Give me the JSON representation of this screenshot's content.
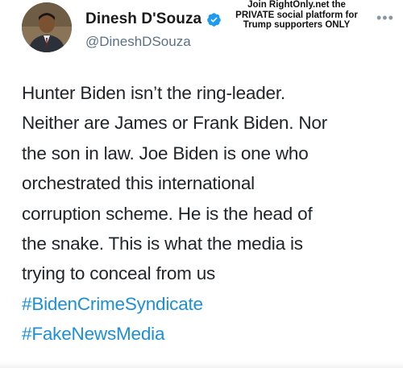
{
  "user": {
    "display_name": "Dinesh D'Souza",
    "handle": "@DineshDSouza",
    "verified": true,
    "avatar_icon": "profile-photo"
  },
  "promo_overlay": {
    "line1": "Join RightOnly.net the",
    "line2": "PRIVATE social platform for",
    "line3": "Trump supporters ONLY"
  },
  "more_icon": "ellipsis-icon",
  "tweet": {
    "lines": [
      "Hunter Biden isn’t the ring-leader.",
      "Neither are James or Frank Biden. Nor",
      "the son in law. Joe Biden is one who",
      "orchestrated this international",
      "corruption scheme.  He is the head of",
      "the snake. This is what the media is",
      "trying to conceal from us"
    ],
    "hashtags": [
      "#BidenCrimeSyndicate",
      "#FakeNewsMedia"
    ]
  },
  "colors": {
    "link": "#1d8fd6",
    "verified": "#1d9bf0",
    "handle": "#5b7083"
  }
}
